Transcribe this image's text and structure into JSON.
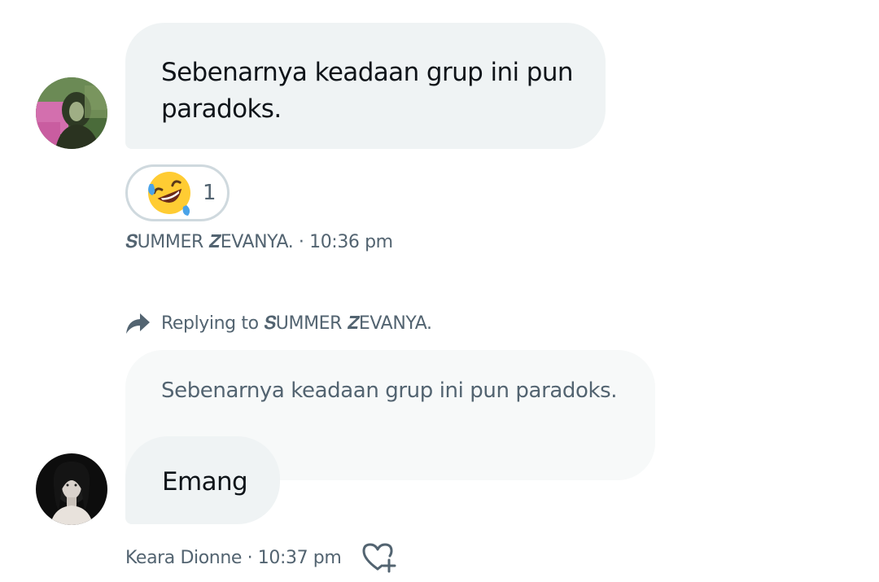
{
  "messages": [
    {
      "lines": [
        "Sebenarnya keadaan grup ini pun",
        "paradoks."
      ],
      "reaction": {
        "emoji": "rolling-on-floor-laughing",
        "count": "1"
      },
      "meta": "𝑺UMMER 𝒁EVANYA. · 10:36 pm",
      "avatar": "avatar-summer"
    },
    {
      "replying_to": "Replying to 𝑺UMMER 𝒁EVANYA.",
      "quoted_text": "Sebenarnya keadaan grup ini pun paradoks.",
      "text": "Emang",
      "meta": "Keara Dionne · 10:37 pm",
      "avatar": "avatar-keara"
    }
  ],
  "icons": {
    "reply": "reply-arrow-icon",
    "add_reaction": "heart-plus-icon"
  },
  "colors": {
    "bubble": "#eff3f4",
    "quoted_bubble": "#f7f9f9",
    "meta_text": "#536471",
    "reaction_border": "#cfd9de"
  }
}
